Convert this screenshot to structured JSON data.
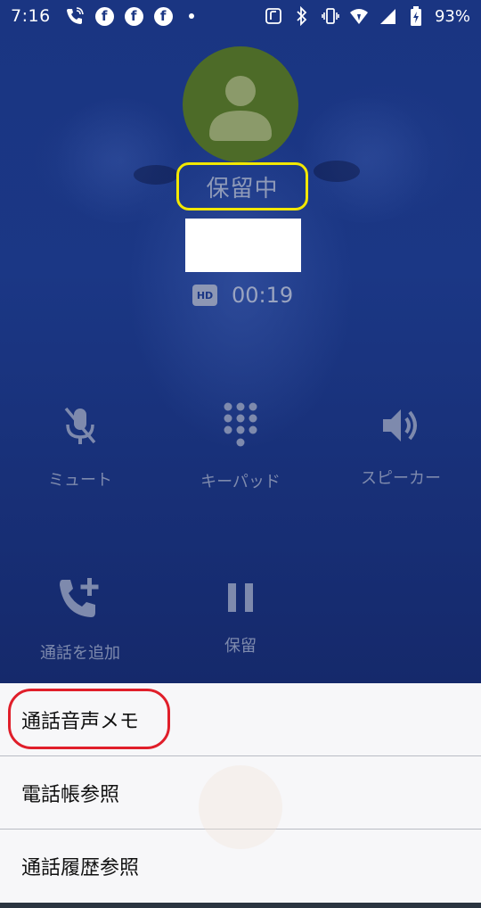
{
  "status_bar": {
    "time": "7:16",
    "battery": "93%",
    "facebook_letter": "f"
  },
  "call": {
    "status": "保留中",
    "hd_badge": "HD",
    "timer": "00:19"
  },
  "controls": {
    "mute": "ミュート",
    "keypad": "キーパッド",
    "speaker": "スピーカー",
    "add_call": "通話を追加",
    "hold": "保留"
  },
  "menu": {
    "items": [
      "通話音声メモ",
      "電話帳参照",
      "通話履歴参照"
    ]
  },
  "colors": {
    "background": "#1b3785",
    "avatar": "#4d6b28",
    "highlight_yellow": "#f2e800",
    "highlight_red": "#e01e2a",
    "sheet": "#f7f7f9"
  }
}
